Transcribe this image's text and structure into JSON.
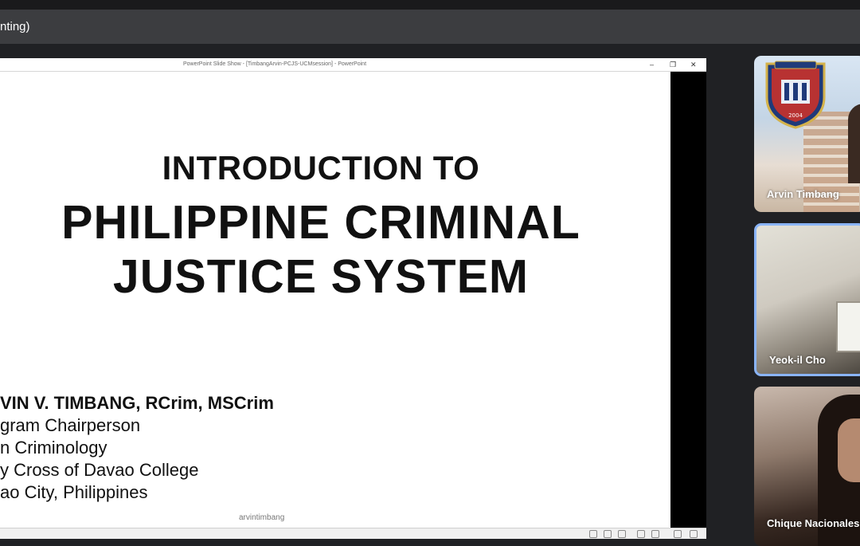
{
  "meet": {
    "presenting_label": "nting)"
  },
  "ppt": {
    "window_title": "PowerPoint Slide Show - [TimbangArvin-PCJS-UCMsession] - PowerPoint",
    "controls": [
      "–",
      "❐",
      "✕"
    ]
  },
  "slide": {
    "title_line1": "INTRODUCTION TO",
    "title_line2": "PHILIPPINE CRIMINAL",
    "title_line3": "JUSTICE SYSTEM",
    "author_line1": "VIN V. TIMBANG, RCrim, MSCrim",
    "author_line2": "gram Chairperson",
    "author_line3": "n Criminology",
    "author_line4": "y Cross of Davao College",
    "author_line5": "ao City, Philippines",
    "watermark": "arvintimbang"
  },
  "participants": [
    {
      "name": "Arvin Timbang",
      "logo_year": "2004"
    },
    {
      "name": "Yeok-il Cho"
    },
    {
      "name": "Chique Nacionales"
    }
  ],
  "colors": {
    "background": "#202124",
    "bar": "#3c3d40",
    "active_speaker_border": "#8ab4f8"
  }
}
